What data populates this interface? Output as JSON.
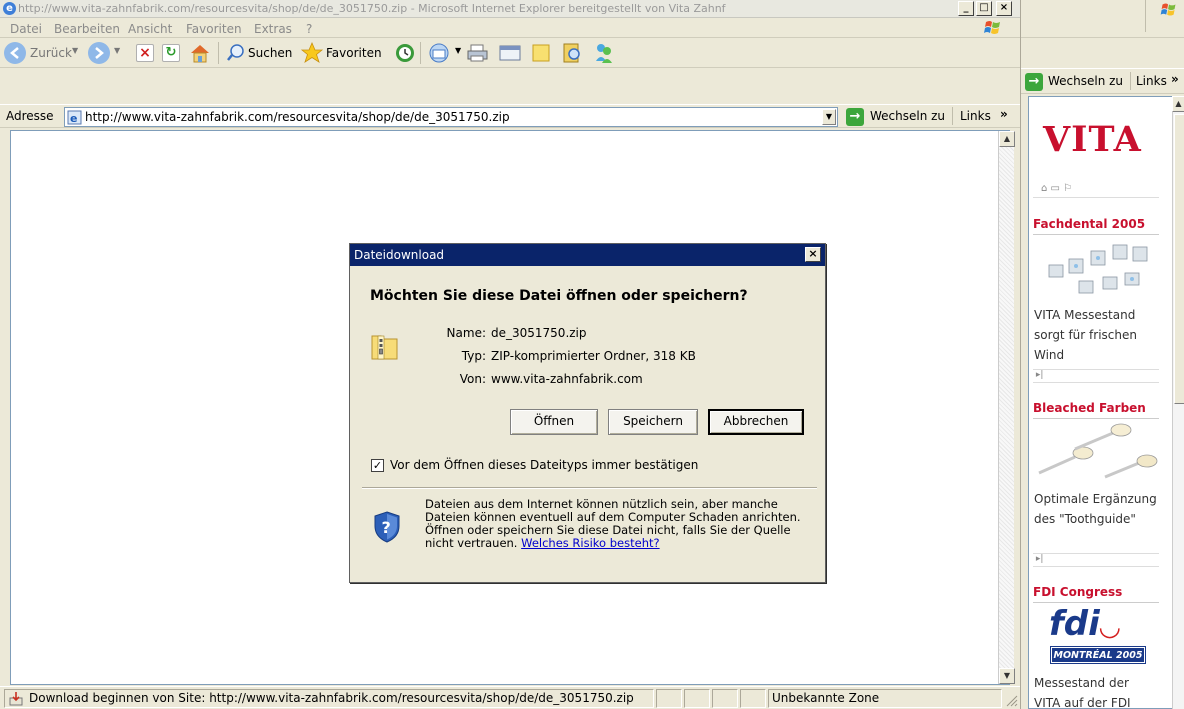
{
  "window": {
    "title": "http://www.vita-zahnfabrik.com/resourcesvita/shop/de/de_3051750.zip - Microsoft Internet Explorer bereitgestellt von Vita Zahnf",
    "minimize": "_",
    "maximize": "□",
    "close": "×"
  },
  "menu": [
    "Datei",
    "Bearbeiten",
    "Ansicht",
    "Favoriten",
    "Extras",
    "?"
  ],
  "toolbar": {
    "back_label": "Zurück",
    "search_label": "Suchen",
    "favorites_label": "Favoriten"
  },
  "address": {
    "label": "Adresse",
    "url": "http://www.vita-zahnfabrik.com/resourcesvita/shop/de/de_3051750.zip",
    "go_label": "Wechseln zu",
    "links_label": "Links",
    "chevron": "»"
  },
  "status": {
    "text": "Download beginnen von Site: http://www.vita-zahnfabrik.com/resourcesvita/shop/de/de_3051750.zip",
    "zone": "Unbekannte Zone"
  },
  "dialog": {
    "title": "Dateidownload",
    "question": "Möchten Sie diese Datei öffnen oder speichern?",
    "name_label": "Name:",
    "name_value": "de_3051750.zip",
    "type_label": "Typ:",
    "type_value": "ZIP-komprimierter Ordner, 318 KB",
    "from_label": "Von:",
    "from_value": "www.vita-zahnfabrik.com",
    "open_button": "Öffnen",
    "save_button": "Speichern",
    "cancel_button": "Abbrechen",
    "checkbox_checked": true,
    "checkbox_label": "Vor dem Öffnen dieses Dateityps immer bestätigen",
    "warning_text": "Dateien aus dem Internet können nützlich sein, aber manche Dateien können eventuell auf dem Computer Schaden anrichten. Öffnen oder speichern Sie diese Datei nicht, falls Sie der Quelle nicht vertrauen.",
    "risk_link": "Welches Risiko besteht?"
  },
  "side": {
    "go_label": "Wechseln zu",
    "links_label": "Links",
    "chevron": "»",
    "logo": "VITA",
    "sections": [
      {
        "title": "Fachdental 2005",
        "text": "VITA Messestand sorgt für frischen Wind"
      },
      {
        "title": "Bleached Farben",
        "text": "Optimale Ergänzung des \"Toothguide\""
      },
      {
        "title": "FDI Congress",
        "text": "Messestand der VITA auf der FDI"
      }
    ],
    "fdi_logo": "fdi",
    "fdi_sub": "MONTRÉAL 2005"
  },
  "colors": {
    "dialog_title_bg": "#0a246a",
    "vita_red": "#c8102e",
    "window_bg": "#ece9d8"
  }
}
